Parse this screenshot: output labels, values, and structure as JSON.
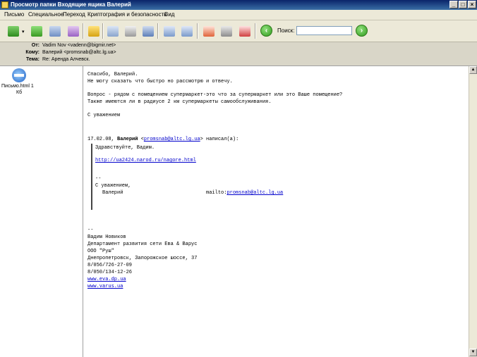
{
  "window": {
    "title": "Просмотр папки Входящие ящика Валерий",
    "min_label": "_",
    "max_label": "□",
    "close_label": "×"
  },
  "menu": [
    "Письмо",
    "Специальное",
    "Переход",
    "Криптография и безопасность",
    "Вид"
  ],
  "toolbar": {
    "search_label": "Поиск:",
    "search_value": ""
  },
  "header": {
    "from_label": "От:",
    "from_value": "Vadim Nov <vadenn@bigmir.net>",
    "to_label": "Кому:",
    "to_value": "Валерий <promsnab@altc.lg.ua>",
    "subject_label": "Тема:",
    "subject_value": "Re: Аренда Алчевск."
  },
  "attachment": {
    "name": "Письмо.html 1",
    "size": "Кб"
  },
  "message": {
    "l1": "Спасибо, Валерий.",
    "l2": "Не могу сказать что быстро но рассмотрю и отвечу.",
    "l3": "Вопрос - рядом с помещением супермаркет-это что за супермаркет или это Ваше помещение?",
    "l4": "Также имеются ли в радиусе 2 км супермаркеты самообслуживания.",
    "l5": "С уважением",
    "q_date": "17.02.08, ",
    "q_name": "Валерий",
    "q_lt": " <",
    "q_email": "promsnab@altc.lg.ua",
    "q_gt": "> написал(а):",
    "q1": "Здравствуйте, Вадим.",
    "q_link": "http://ua2424.narod.ru/nagore.html",
    "q_dash": "--",
    "q_regards": "С уважением,",
    "q_sig_name": "Валерий                            mailto:",
    "q_sig_email": "promsnab@altc.lg.ua",
    "sig_dash": "--",
    "sig1": "Вадим Новиков",
    "sig2": "Департамент развития сети Ева & Варус",
    "sig3": "ООО \"Руш\"",
    "sig4": "Днепропетровск, Запорожское шоссе, 37",
    "sig5": "8/056/726-27-09",
    "sig6": "8/050/134-12-26",
    "sig7": "www.eva.dp.ua",
    "sig8": "www.varus.ua"
  }
}
